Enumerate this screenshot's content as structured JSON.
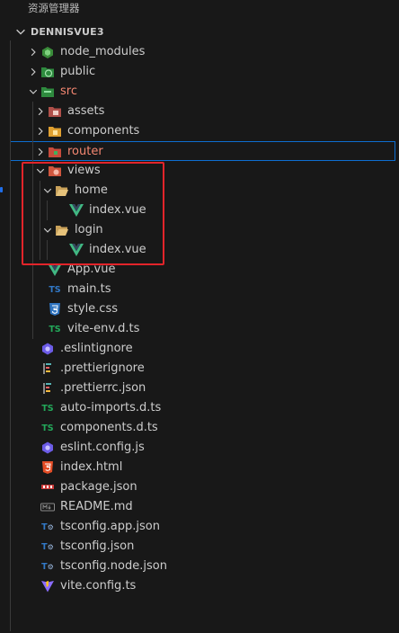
{
  "panel_title": "资源管理器",
  "project": "DENNISVUE3",
  "items": [
    {
      "label": "node_modules",
      "indent": 0,
      "chevron": "right",
      "icon": "folder-node",
      "red": false
    },
    {
      "label": "public",
      "indent": 0,
      "chevron": "right",
      "icon": "folder-public",
      "red": false
    },
    {
      "label": "src",
      "indent": 0,
      "chevron": "down",
      "icon": "folder-src",
      "red": true
    },
    {
      "label": "assets",
      "indent": 1,
      "chevron": "right",
      "icon": "folder-assets",
      "red": false
    },
    {
      "label": "components",
      "indent": 1,
      "chevron": "right",
      "icon": "folder-components",
      "red": false
    },
    {
      "label": "router",
      "indent": 1,
      "chevron": "right",
      "icon": "folder-router",
      "red": true,
      "selected": true
    },
    {
      "label": "views",
      "indent": 1,
      "chevron": "down",
      "icon": "folder-views",
      "red": false
    },
    {
      "label": "home",
      "indent": 2,
      "chevron": "down",
      "icon": "folder-open",
      "red": false
    },
    {
      "label": "index.vue",
      "indent": 3,
      "chevron": "none",
      "icon": "vue",
      "red": false
    },
    {
      "label": "login",
      "indent": 2,
      "chevron": "down",
      "icon": "folder-open",
      "red": false
    },
    {
      "label": "index.vue",
      "indent": 3,
      "chevron": "none",
      "icon": "vue",
      "red": false
    },
    {
      "label": "App.vue",
      "indent": 1,
      "chevron": "none",
      "icon": "vue",
      "red": false
    },
    {
      "label": "main.ts",
      "indent": 1,
      "chevron": "none",
      "icon": "ts-blue",
      "red": false
    },
    {
      "label": "style.css",
      "indent": 1,
      "chevron": "none",
      "icon": "css",
      "red": false
    },
    {
      "label": "vite-env.d.ts",
      "indent": 1,
      "chevron": "none",
      "icon": "ts-green",
      "red": false
    },
    {
      "label": ".eslintignore",
      "indent": 0,
      "chevron": "none",
      "icon": "eslint",
      "red": false
    },
    {
      "label": ".prettierignore",
      "indent": 0,
      "chevron": "none",
      "icon": "prettier",
      "red": false
    },
    {
      "label": ".prettierrc.json",
      "indent": 0,
      "chevron": "none",
      "icon": "prettier",
      "red": false
    },
    {
      "label": "auto-imports.d.ts",
      "indent": 0,
      "chevron": "none",
      "icon": "ts-green",
      "red": false
    },
    {
      "label": "components.d.ts",
      "indent": 0,
      "chevron": "none",
      "icon": "ts-green",
      "red": false
    },
    {
      "label": "eslint.config.js",
      "indent": 0,
      "chevron": "none",
      "icon": "eslint",
      "red": false
    },
    {
      "label": "index.html",
      "indent": 0,
      "chevron": "none",
      "icon": "html",
      "red": false
    },
    {
      "label": "package.json",
      "indent": 0,
      "chevron": "none",
      "icon": "npm",
      "red": false
    },
    {
      "label": "README.md",
      "indent": 0,
      "chevron": "none",
      "icon": "markdown",
      "red": false
    },
    {
      "label": "tsconfig.app.json",
      "indent": 0,
      "chevron": "none",
      "icon": "tsconfig",
      "red": false
    },
    {
      "label": "tsconfig.json",
      "indent": 0,
      "chevron": "none",
      "icon": "tsconfig",
      "red": false
    },
    {
      "label": "tsconfig.node.json",
      "indent": 0,
      "chevron": "none",
      "icon": "tsconfig",
      "red": false
    },
    {
      "label": "vite.config.ts",
      "indent": 0,
      "chevron": "none",
      "icon": "vite",
      "red": false
    }
  ],
  "colors": {
    "background": "#181818",
    "text": "#cccccc",
    "modified_red": "#f48771",
    "selection_blue": "#0e6ed1",
    "highlight_box": "#e2242a",
    "vue_green": "#41b883",
    "ts_blue": "#3178c6",
    "ts_green": "#23a85a"
  }
}
